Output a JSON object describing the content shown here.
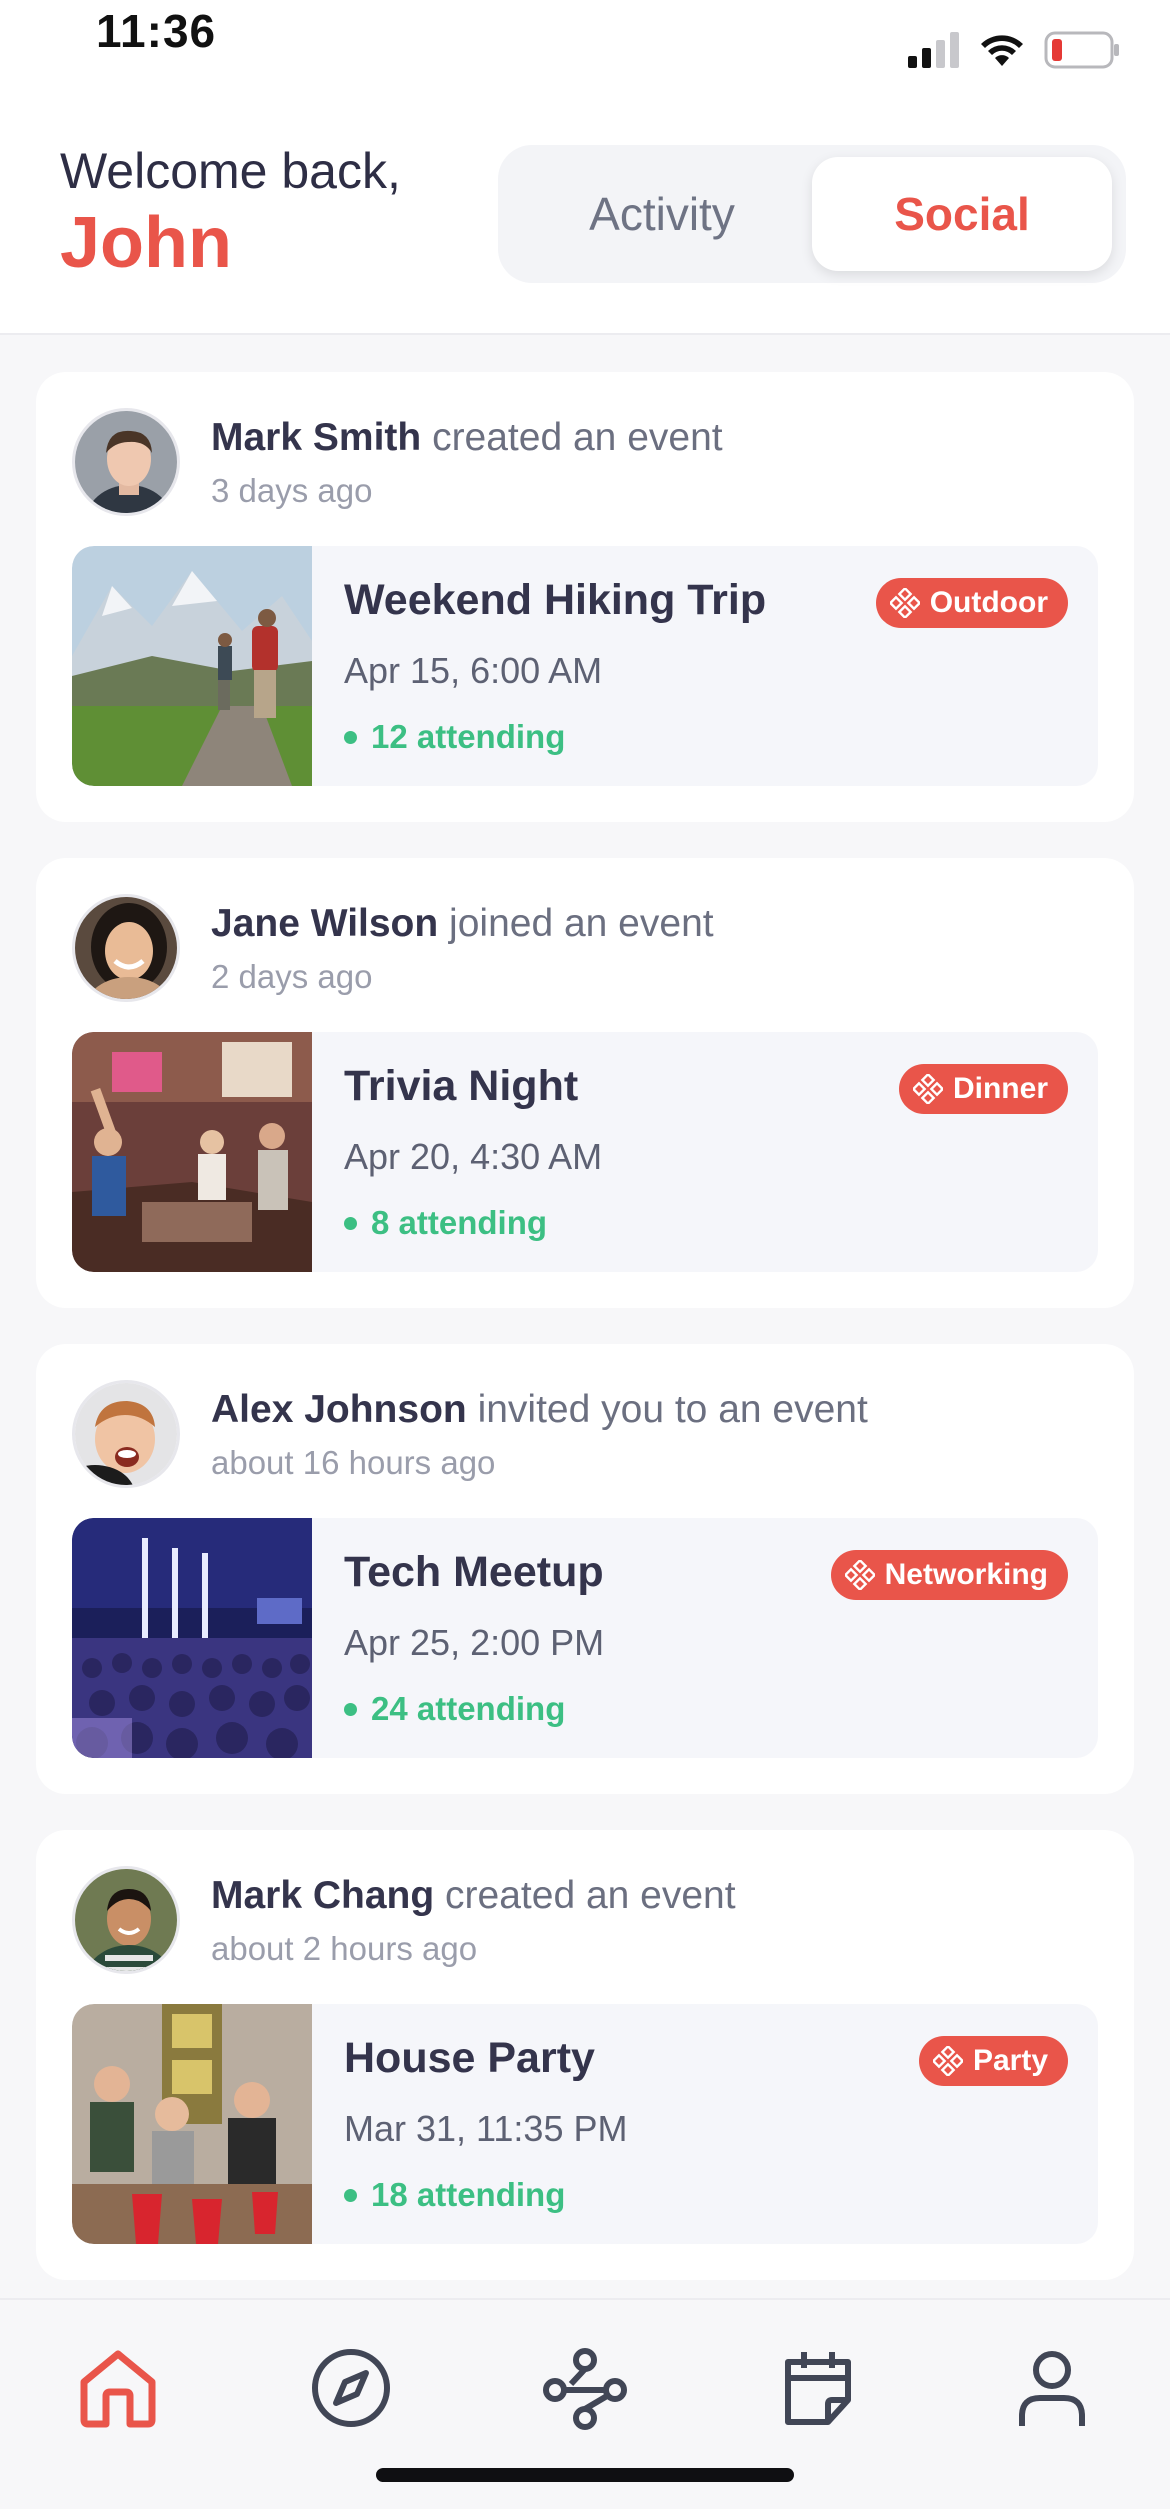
{
  "status_bar": {
    "time": "11:36"
  },
  "header": {
    "welcome": "Welcome back,",
    "name": "John",
    "tabs": [
      {
        "label": "Activity",
        "active": false
      },
      {
        "label": "Social",
        "active": true
      }
    ]
  },
  "colors": {
    "accent": "#e9554a",
    "attending": "#3cbf83",
    "text": "#34344c"
  },
  "feed": [
    {
      "actor": "Mark Smith",
      "action": "created an event",
      "time": "3 days ago",
      "event": {
        "title": "Weekend Hiking Trip",
        "date": "Apr 15, 6:00 AM",
        "attending": "12 attending",
        "tag": "Outdoor"
      }
    },
    {
      "actor": "Jane Wilson",
      "action": "joined an event",
      "time": "2 days ago",
      "event": {
        "title": "Trivia Night",
        "date": "Apr 20, 4:30 AM",
        "attending": "8 attending",
        "tag": "Dinner"
      }
    },
    {
      "actor": "Alex Johnson",
      "action": "invited you to an event",
      "time": "about 16 hours ago",
      "event": {
        "title": "Tech Meetup",
        "date": "Apr 25, 2:00 PM",
        "attending": "24 attending",
        "tag": "Networking"
      }
    },
    {
      "actor": "Mark Chang",
      "action": "created an event",
      "time": "about 2 hours ago",
      "event": {
        "title": "House Party",
        "date": "Mar 31, 11:35 PM",
        "attending": "18 attending",
        "tag": "Party"
      }
    }
  ],
  "bottom_nav": [
    {
      "icon": "home-icon",
      "active": true
    },
    {
      "icon": "compass-icon",
      "active": false
    },
    {
      "icon": "network-icon",
      "active": false
    },
    {
      "icon": "calendar-icon",
      "active": false
    },
    {
      "icon": "profile-icon",
      "active": false
    }
  ]
}
